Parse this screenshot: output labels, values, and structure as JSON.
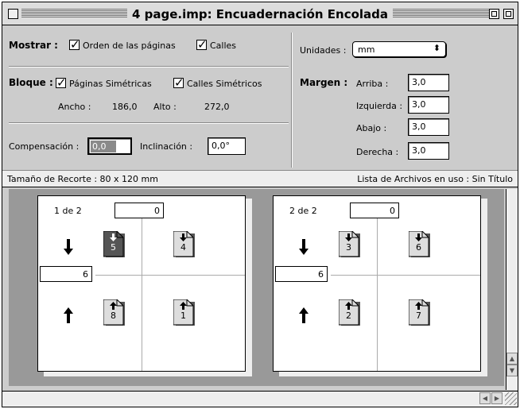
{
  "window": {
    "title": "4 page.imp: Encuadernación Encolada"
  },
  "mostrar": {
    "label": "Mostrar :",
    "orden_label": "Orden de las páginas",
    "orden_checked": true,
    "calles_label": "Calles",
    "calles_checked": true
  },
  "bloque": {
    "label": "Bloque :",
    "simetricas_label": "Páginas Simétricas",
    "simetricas_checked": true,
    "calles_sim_label": "Calles Simétricos",
    "calles_sim_checked": true,
    "ancho_label": "Ancho :",
    "ancho_value": "186,0",
    "alto_label": "Alto :",
    "alto_value": "272,0"
  },
  "compensacion": {
    "label": "Compensación :",
    "value": "0,0",
    "inclinacion_label": "Inclinación :",
    "inclinacion_value": "0,0°"
  },
  "unidades": {
    "label": "Unidades :",
    "value": "mm"
  },
  "margen": {
    "label": "Margen :",
    "arriba_label": "Arriba :",
    "arriba_value": "3,0",
    "izquierda_label": "Izquierda :",
    "izquierda_value": "3,0",
    "abajo_label": "Abajo :",
    "abajo_value": "3,0",
    "derecha_label": "Derecha :",
    "derecha_value": "3,0"
  },
  "status": {
    "recorte": "Tamaño de Recorte : 80 x 120 mm",
    "archivos": "Lista de Archivos en uso : Sin Título"
  },
  "sheets": [
    {
      "label": "1 de 2",
      "offset_top": "0",
      "offset_left": "6",
      "pages": [
        {
          "num": "5",
          "dir": "down",
          "selected": true
        },
        {
          "num": "4",
          "dir": "down",
          "selected": false
        },
        {
          "num": "8",
          "dir": "up",
          "selected": false
        },
        {
          "num": "1",
          "dir": "up",
          "selected": false
        }
      ]
    },
    {
      "label": "2 de 2",
      "offset_top": "0",
      "offset_left": "6",
      "pages": [
        {
          "num": "3",
          "dir": "down",
          "selected": false
        },
        {
          "num": "6",
          "dir": "down",
          "selected": false
        },
        {
          "num": "2",
          "dir": "up",
          "selected": false
        },
        {
          "num": "7",
          "dir": "up",
          "selected": false
        }
      ]
    }
  ],
  "colors": {
    "window_bg": "#cccccc",
    "canvas_bg": "#999999",
    "selected_page": "#555555",
    "page_fill": "#dddddd"
  },
  "icons": [
    "close-box-icon",
    "zoom-box-icon",
    "collapse-box-icon",
    "arrow-down-icon",
    "arrow-up-icon",
    "page-icon",
    "checkmark-icon",
    "popup-arrows-icon",
    "scroll-up-icon",
    "scroll-down-icon",
    "scroll-left-icon",
    "scroll-right-icon",
    "grow-box-icon"
  ]
}
